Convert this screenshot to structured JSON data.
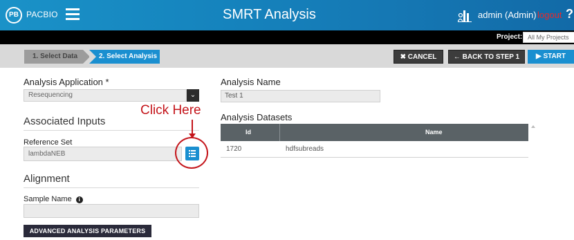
{
  "header": {
    "logo_text": "PB",
    "brand": "PACBIO",
    "app_title": "SMRT Analysis",
    "user": "admin (Admin)",
    "logout": "logout",
    "help": "?"
  },
  "project_bar": {
    "label": "Project:",
    "selected": "All My Projects"
  },
  "steps": {
    "step1": "1. Select Data",
    "step2": "2. Select Analysis",
    "cancel": "CANCEL",
    "back": "BACK TO STEP 1",
    "start": "START"
  },
  "form": {
    "analysis_application_label": "Analysis Application *",
    "analysis_application_value": "Resequencing",
    "associated_inputs": "Associated Inputs",
    "reference_set_label": "Reference Set",
    "reference_set_value": "lambdaNEB",
    "alignment": "Alignment",
    "sample_name_label": "Sample Name",
    "sample_name_value": "",
    "advanced_button": "ADVANCED ANALYSIS PARAMETERS"
  },
  "annotation": {
    "text": "Click Here",
    "color": "#c4141a"
  },
  "analysis": {
    "name_label": "Analysis Name",
    "name_value": "Test 1",
    "datasets_label": "Analysis Datasets",
    "columns": [
      "Id",
      "Name"
    ],
    "rows": [
      {
        "id": "1720",
        "name": "hdfsubreads"
      }
    ]
  },
  "colors": {
    "accent": "#1a8fd0",
    "header": "#1583bd",
    "table_header": "#5a6266"
  }
}
